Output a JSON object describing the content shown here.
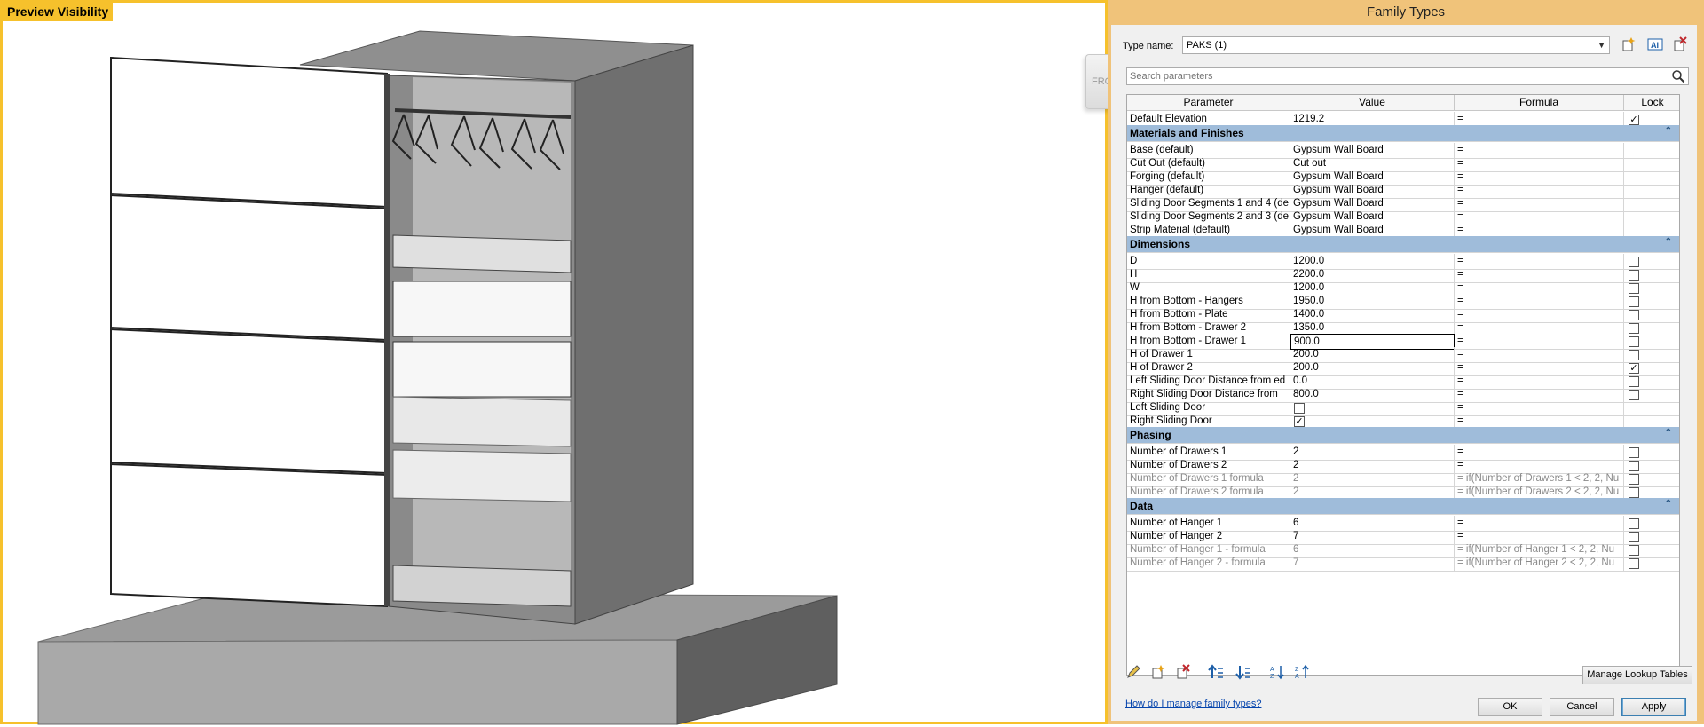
{
  "preview": {
    "label": "Preview Visibility",
    "viewcube_label": "FRO"
  },
  "dialog": {
    "title": "Family Types",
    "type_name_label": "Type name:",
    "type_name_value": "PAKS (1)",
    "search_placeholder": "Search parameters",
    "columns": {
      "parameter": "Parameter",
      "value": "Value",
      "formula": "Formula",
      "lock": "Lock"
    },
    "rows": [
      {
        "kind": "param",
        "name": "Default Elevation",
        "value": "1219.2",
        "formula": "=",
        "lock": true,
        "dim": false
      },
      {
        "kind": "group",
        "name": "Materials and Finishes"
      },
      {
        "kind": "param",
        "name": "Base (default)",
        "value": "Gypsum Wall Board",
        "formula": "=",
        "lock": null,
        "dim": false
      },
      {
        "kind": "param",
        "name": "Cut Out (default)",
        "value": "Cut out",
        "formula": "=",
        "lock": null,
        "dim": false
      },
      {
        "kind": "param",
        "name": "Forging (default)",
        "value": "Gypsum Wall Board",
        "formula": "=",
        "lock": null,
        "dim": false
      },
      {
        "kind": "param",
        "name": "Hanger (default)",
        "value": "Gypsum Wall Board",
        "formula": "=",
        "lock": null,
        "dim": false
      },
      {
        "kind": "param",
        "name": "Sliding Door Segments 1 and 4 (de",
        "value": "Gypsum Wall Board",
        "formula": "=",
        "lock": null,
        "dim": false
      },
      {
        "kind": "param",
        "name": "Sliding Door Segments 2 and 3 (de",
        "value": "Gypsum Wall Board",
        "formula": "=",
        "lock": null,
        "dim": false
      },
      {
        "kind": "param",
        "name": "Strip Material (default)",
        "value": "Gypsum Wall Board",
        "formula": "=",
        "lock": null,
        "dim": false
      },
      {
        "kind": "group",
        "name": "Dimensions"
      },
      {
        "kind": "param",
        "name": "D",
        "value": "1200.0",
        "formula": "=",
        "lock": false,
        "dim": false
      },
      {
        "kind": "param",
        "name": "H",
        "value": "2200.0",
        "formula": "=",
        "lock": false,
        "dim": false
      },
      {
        "kind": "param",
        "name": "W",
        "value": "1200.0",
        "formula": "=",
        "lock": false,
        "dim": false
      },
      {
        "kind": "param",
        "name": "H from Bottom - Hangers",
        "value": "1950.0",
        "formula": "=",
        "lock": false,
        "dim": false
      },
      {
        "kind": "param",
        "name": "H from Bottom - Plate",
        "value": "1400.0",
        "formula": "=",
        "lock": false,
        "dim": false
      },
      {
        "kind": "param",
        "name": "H from Bottom - Drawer 2",
        "value": "1350.0",
        "formula": "=",
        "lock": false,
        "dim": false
      },
      {
        "kind": "param",
        "name": "H from Bottom - Drawer 1",
        "value": "900.0",
        "formula": "=",
        "lock": false,
        "dim": false,
        "editing": true
      },
      {
        "kind": "param",
        "name": "H of Drawer 1",
        "value": "200.0",
        "formula": "=",
        "lock": false,
        "dim": false
      },
      {
        "kind": "param",
        "name": "H of Drawer 2",
        "value": "200.0",
        "formula": "=",
        "lock": true,
        "dim": false
      },
      {
        "kind": "param",
        "name": "Left Sliding Door Distance from ed",
        "value": "0.0",
        "formula": "=",
        "lock": false,
        "dim": false
      },
      {
        "kind": "param",
        "name": "Right Sliding Door Distance from",
        "value": "800.0",
        "formula": "=",
        "lock": false,
        "dim": false
      },
      {
        "kind": "param",
        "name": "Left Sliding Door",
        "value": "",
        "value_checkbox": false,
        "formula": "=",
        "lock": null,
        "dim": false
      },
      {
        "kind": "param",
        "name": "Right Sliding Door",
        "value": "",
        "value_checkbox": true,
        "formula": "=",
        "lock": null,
        "dim": false
      },
      {
        "kind": "group",
        "name": "Phasing"
      },
      {
        "kind": "param",
        "name": "Number of Drawers 1",
        "value": "2",
        "formula": "=",
        "lock": false,
        "dim": false
      },
      {
        "kind": "param",
        "name": "Number of Drawers 2",
        "value": "2",
        "formula": "=",
        "lock": false,
        "dim": false
      },
      {
        "kind": "param",
        "name": "Number of Drawers 1 formula",
        "value": "2",
        "formula": "= if(Number of Drawers 1 < 2, 2, Nu",
        "lock": false,
        "dim": true
      },
      {
        "kind": "param",
        "name": "Number of Drawers 2 formula",
        "value": "2",
        "formula": "= if(Number of Drawers 2 < 2, 2, Nu",
        "lock": false,
        "dim": true
      },
      {
        "kind": "group",
        "name": "Data"
      },
      {
        "kind": "param",
        "name": "Number of Hanger 1",
        "value": "6",
        "formula": "=",
        "lock": false,
        "dim": false
      },
      {
        "kind": "param",
        "name": "Number of Hanger 2",
        "value": "7",
        "formula": "=",
        "lock": false,
        "dim": false
      },
      {
        "kind": "param",
        "name": "Number of Hanger 1 - formula",
        "value": "6",
        "formula": "= if(Number of Hanger 1 < 2, 2, Nu",
        "lock": false,
        "dim": true
      },
      {
        "kind": "param",
        "name": "Number of Hanger 2 - formula",
        "value": "7",
        "formula": "= if(Number of Hanger 2 < 2, 2, Nu",
        "lock": false,
        "dim": true
      }
    ],
    "buttons": {
      "lookup": "Manage Lookup Tables",
      "ok": "OK",
      "cancel": "Cancel",
      "apply": "Apply"
    },
    "help_link": "How do I manage family types?"
  },
  "icons": {
    "new_type": "new-type-icon",
    "rename_type": "rename-type-icon",
    "delete_type": "delete-type-icon",
    "search": "search-icon",
    "collapse": "collapse-chevrons-icon",
    "edit_param": "pencil-icon",
    "new_param": "new-parameter-icon",
    "remove_param": "delete-parameter-icon",
    "move_up": "move-up-icon",
    "move_down": "move-down-icon",
    "sort_asc": "sort-ascending-icon",
    "sort_desc": "sort-descending-icon"
  },
  "colors": {
    "preview_border": "#f6c12c",
    "dialog_frame": "#f0c37a",
    "group_header": "#9fbcda",
    "link": "#0645ad"
  }
}
